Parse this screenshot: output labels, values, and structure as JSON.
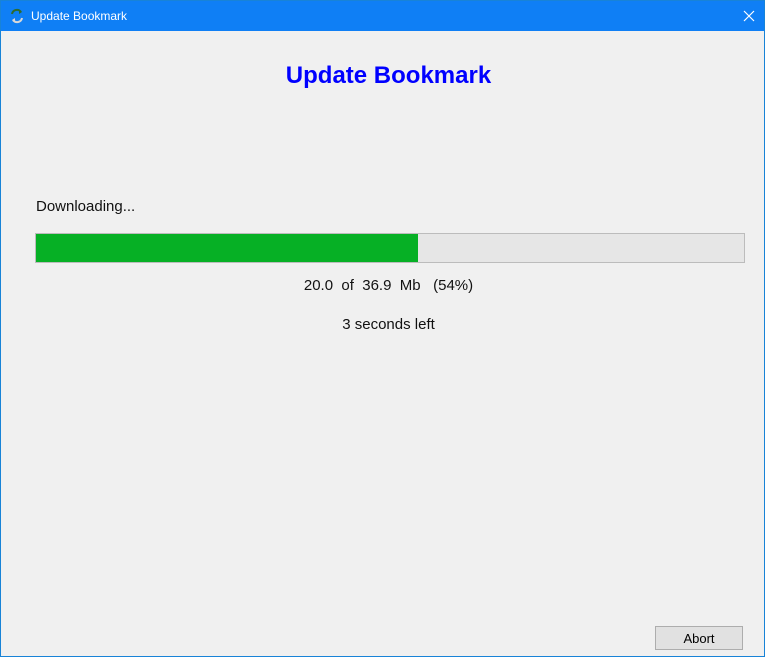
{
  "window": {
    "title": "Update Bookmark",
    "icon": "recycle-arrows-icon"
  },
  "dialog": {
    "heading": "Update Bookmark",
    "status_label": "Downloading...",
    "progress": {
      "downloaded_mb": 20.0,
      "total_mb": 36.9,
      "percent": 54,
      "text": "20.0  of  36.9  Mb   (54%)"
    },
    "time_left": "3 seconds left",
    "abort_label": "Abort"
  },
  "colors": {
    "titlebar": "#0f7ff5",
    "heading": "#0000ff",
    "progress_fill": "#06b025",
    "progress_track": "#e6e6e6",
    "background": "#f0f0f0"
  }
}
